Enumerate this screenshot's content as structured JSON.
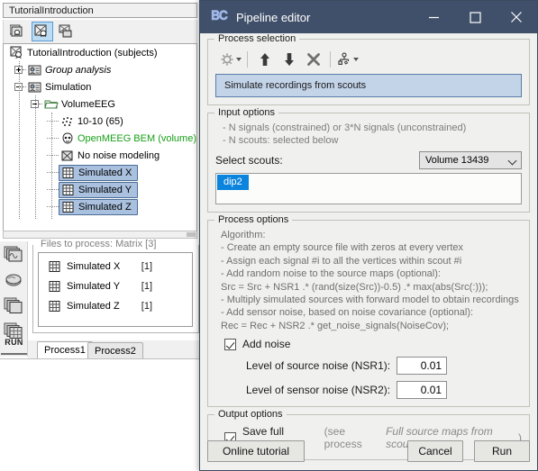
{
  "background_app": {
    "panel_title": "TutorialIntroduction",
    "toolbar": {
      "buttons": [
        {
          "name": "protocols-icon",
          "label": ""
        },
        {
          "name": "subjects-icon",
          "label": ""
        },
        {
          "name": "functional-data-icon",
          "label": ""
        }
      ]
    },
    "tree": [
      {
        "label": "TutorialIntroduction (subjects)",
        "icon": "subjects-icon",
        "depth": 0,
        "expander": "none",
        "style": "normal",
        "selected": false
      },
      {
        "label": "Group analysis",
        "icon": "subject-icon",
        "depth": 1,
        "expander": "plus",
        "style": "italic",
        "selected": false
      },
      {
        "label": "Simulation",
        "icon": "subject-icon",
        "depth": 1,
        "expander": "minus",
        "style": "normal",
        "selected": false
      },
      {
        "label": "VolumeEEG",
        "icon": "folder-icon",
        "depth": 2,
        "expander": "minus",
        "style": "normal",
        "selected": false
      },
      {
        "label": "10-10 (65)",
        "icon": "channel-icon",
        "depth": 3,
        "expander": "none",
        "style": "normal",
        "selected": false
      },
      {
        "label": "OpenMEEG BEM (volume)",
        "icon": "headmodel-icon",
        "depth": 3,
        "expander": "none",
        "style": "green",
        "selected": false
      },
      {
        "label": "No noise modeling",
        "icon": "noisecov-icon",
        "depth": 3,
        "expander": "none",
        "style": "normal",
        "selected": false
      },
      {
        "label": "Simulated X",
        "icon": "matrix-icon",
        "depth": 3,
        "expander": "none",
        "style": "normal",
        "selected": true
      },
      {
        "label": "Simulated Y",
        "icon": "matrix-icon",
        "depth": 3,
        "expander": "none",
        "style": "normal",
        "selected": true
      },
      {
        "label": "Simulated Z",
        "icon": "matrix-icon",
        "depth": 3,
        "expander": "none",
        "style": "normal",
        "selected": true
      }
    ],
    "vertical_toolbar": {
      "buttons": [
        {
          "name": "recordings-icon"
        },
        {
          "name": "sources-icon"
        },
        {
          "name": "timefreq-icon"
        },
        {
          "name": "matrix-icon"
        }
      ],
      "run_label": "RUN"
    },
    "files_group": {
      "legend": "Files to process: Matrix [3]",
      "rows": [
        {
          "name": "Simulated X",
          "count": "[1]"
        },
        {
          "name": "Simulated Y",
          "count": "[1]"
        },
        {
          "name": "Simulated Z",
          "count": "[1]"
        }
      ]
    },
    "tabs": [
      {
        "label": "Process1",
        "selected": true
      },
      {
        "label": "Process2",
        "selected": false
      }
    ]
  },
  "dialog": {
    "title": "Pipeline editor",
    "logo": "BS",
    "window_buttons": {
      "minimize": "–",
      "maximize": "☐",
      "close": "✕"
    },
    "process_selection": {
      "legend": "Process selection",
      "toolbar_icons": [
        {
          "name": "gear-dropdown-icon",
          "has_caret": true
        },
        {
          "name": "move-up-icon",
          "has_caret": false
        },
        {
          "name": "move-down-icon",
          "has_caret": false
        },
        {
          "name": "delete-icon",
          "has_caret": false
        },
        {
          "name": "pipeline-dropdown-icon",
          "has_caret": true
        }
      ],
      "selected_process": "Simulate recordings from scouts"
    },
    "input_options": {
      "legend": "Input options",
      "hints": [
        "- N signals (constrained) or 3*N signals (unconstrained)",
        "- N scouts: selected below"
      ],
      "select_scouts_label": "Select scouts:",
      "surface_combo_value": "Volume 13439",
      "scouts": [
        {
          "label": "dip2",
          "selected": true
        }
      ]
    },
    "process_options": {
      "legend": "Process options",
      "algorithm_title": "Algorithm:",
      "algorithm_lines": [
        {
          "text": "- Create an empty source file with zeros at every vertex",
          "italic": false
        },
        {
          "text": "- Assign each signal #i to all the vertices within scout #i",
          "italic": false
        },
        {
          "text": "- Add random noise to the source maps (optional):",
          "italic": false
        },
        {
          "text": "  Src = Src + NSR1 .* (rand(size(Src))-0.5) .* max(abs(Src(:)));",
          "italic": true
        },
        {
          "text": "- Multiply simulated sources with forward model to obtain recordings",
          "italic": false
        },
        {
          "text": "- Add sensor noise, based on noise covariance (optional):",
          "italic": false
        },
        {
          "text": "  Rec = Rec + NSR2 .* get_noise_signals(NoiseCov);",
          "italic": true
        }
      ],
      "add_noise": {
        "label": "Add noise",
        "checked": true
      },
      "nsr1": {
        "label": "Level of source noise (NSR1):",
        "value": "0.01"
      },
      "nsr2": {
        "label": "Level of sensor noise (NSR2):",
        "value": "0.01"
      }
    },
    "output_options": {
      "legend": "Output options",
      "save_full_sources": {
        "checked": true,
        "label": "Save full sources",
        "note_prefix": "(see process",
        "note_italic": "Full source maps from scouts",
        "note_suffix": ")"
      }
    },
    "footer": {
      "online_tutorial": "Online tutorial",
      "cancel": "Cancel",
      "run": "Run"
    }
  },
  "colors": {
    "titlebar": "#41506a",
    "dialog_bg": "#f0f0ee",
    "process_selected": "#c3d3e8",
    "tree_selected": "#a9c0de",
    "scout_selected": "#0b84de",
    "green_text": "#17a017",
    "hint_text": "#7c7c7c"
  }
}
